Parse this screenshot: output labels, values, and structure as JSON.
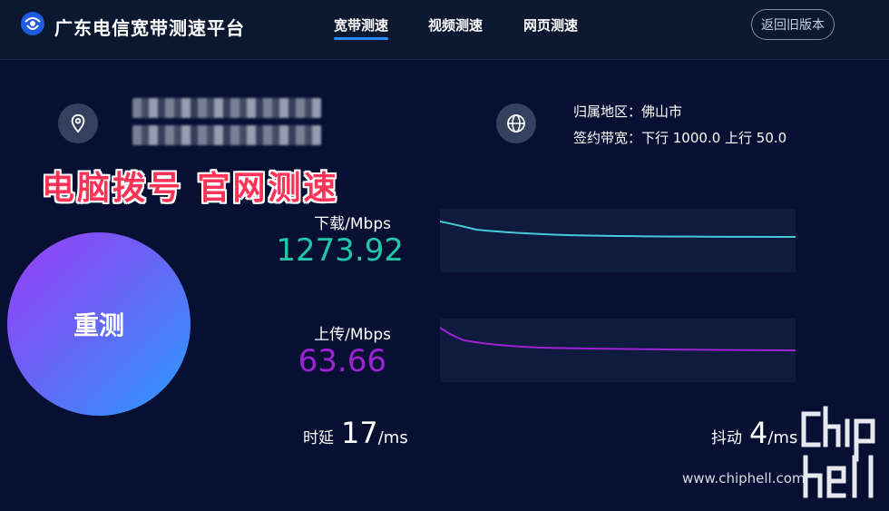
{
  "header": {
    "brand": "广东电信宽带测速平台",
    "tabs": [
      {
        "label": "宽带测速",
        "active": true
      },
      {
        "label": "视频测速",
        "active": false
      },
      {
        "label": "网页测速",
        "active": false
      }
    ],
    "old_version_button": "返回旧版本"
  },
  "info": {
    "region_label": "归属地区：佛山市",
    "bandwidth_label": "签约带宽：下行 1000.0 上行 50.0"
  },
  "overlay_text": "电脑拨号 官网测速",
  "retest_button": "重测",
  "download": {
    "label": "下载/Mbps",
    "value": "1273.92",
    "color": "#1fc8a8",
    "line_color": "#49c9d6"
  },
  "upload": {
    "label": "上传/Mbps",
    "value": "63.66",
    "color": "#9d22d4",
    "line_color": "#9d22d4"
  },
  "latency": {
    "label": "时延",
    "value": "17",
    "unit": "/ms"
  },
  "jitter": {
    "label": "抖动",
    "value": "4",
    "unit": "/ms"
  },
  "watermark": {
    "url": "www.chiphell.com",
    "logo_text": "chip hell"
  },
  "colors": {
    "background": "#071033",
    "header": "#0c1830",
    "accent": "#2a8cff"
  }
}
